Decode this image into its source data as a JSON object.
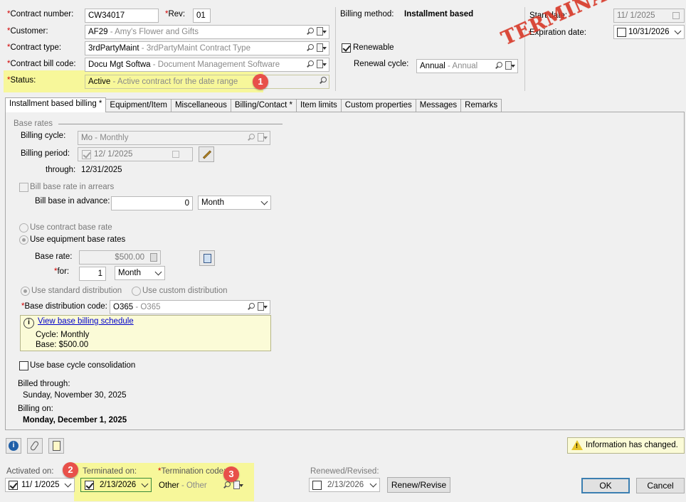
{
  "header": {
    "contract_number_label": "Contract number:",
    "contract_number": "CW34017",
    "rev_label": "Rev:",
    "rev": "01",
    "customer_label": "Customer:",
    "customer_code": "AF29",
    "customer_desc": " - Amy's Flower and Gifts",
    "contract_type_label": "Contract type:",
    "contract_type_code": "3rdPartyMaint",
    "contract_type_desc": " - 3rdPartyMaint Contract Type",
    "bill_code_label": "Contract bill code:",
    "bill_code": "Docu Mgt Softwa",
    "bill_code_desc": " - Document Management Software",
    "status_label": "Status:",
    "status_code": "Active",
    "status_desc": " - Active contract for the date range",
    "billing_method_label": "Billing method:",
    "billing_method": "Installment based",
    "renewable_label": "Renewable",
    "renewal_cycle_label": "Renewal cycle:",
    "renewal_cycle_code": "Annual",
    "renewal_cycle_desc": " - Annual",
    "start_date_label": "Start date:",
    "start_date": "11/  1/2025",
    "expiration_date_label": "Expiration date:",
    "expiration_date": "10/31/2026",
    "stamp": "TERMINATED"
  },
  "tabs": [
    {
      "label": "Installment based billing *"
    },
    {
      "label": "Equipment/Item"
    },
    {
      "label": "Miscellaneous"
    },
    {
      "label": "Billing/Contact *"
    },
    {
      "label": "Item limits"
    },
    {
      "label": "Custom properties"
    },
    {
      "label": "Messages"
    },
    {
      "label": "Remarks"
    }
  ],
  "base_rates": {
    "section_label": "Base rates",
    "billing_cycle_label": "Billing cycle:",
    "billing_cycle_code": "Mo",
    "billing_cycle_desc": " - Monthly",
    "billing_period_label": "Billing period:",
    "billing_period": "12/  1/2025",
    "through_label": "through:",
    "through": "12/31/2025",
    "arrears_label": "Bill base rate in arrears",
    "advance_label": "Bill base in advance:",
    "advance_value": "0",
    "advance_unit": "Month",
    "use_contract_rate_label": "Use contract base rate",
    "use_equipment_rates_label": "Use equipment base rates",
    "base_rate_label": "Base rate:",
    "base_rate": "$500.00",
    "for_label": "for:",
    "for_value": "1",
    "for_unit": "Month",
    "standard_dist_label": "Use standard distribution",
    "custom_dist_label": "Use custom distribution",
    "base_dist_label": "Base distribution code:",
    "base_dist_code": "O365",
    "base_dist_desc": " - O365",
    "schedule_link": "View base billing schedule",
    "schedule_cycle": "Cycle: Monthly",
    "schedule_base": "Base: $500.00",
    "consolidation_label": "Use base cycle consolidation",
    "billed_through_label": "Billed through:",
    "billed_through": "Sunday, November 30, 2025",
    "billing_on_label": "Billing on:",
    "billing_on": "Monday, December 1, 2025"
  },
  "footer": {
    "info_changed": "Information has changed.",
    "activated_label": "Activated on:",
    "activated_on": "11/  1/2025",
    "terminated_label": "Terminated on:",
    "terminated_on": "2/13/2026",
    "termination_code_label": "Termination code:",
    "termination_code": "Other",
    "termination_desc": " - Other",
    "renewed_label": "Renewed/Revised:",
    "renewed_on": "2/13/2026",
    "renew_button": "Renew/Revise",
    "ok_button": "OK",
    "cancel_button": "Cancel"
  },
  "callouts": [
    "1",
    "2",
    "3"
  ],
  "colors": {
    "highlight": "#f7f79a",
    "badge": "#e8504a",
    "stamp": "#d83a2a",
    "required": "#d00000",
    "link": "#0000cc"
  }
}
